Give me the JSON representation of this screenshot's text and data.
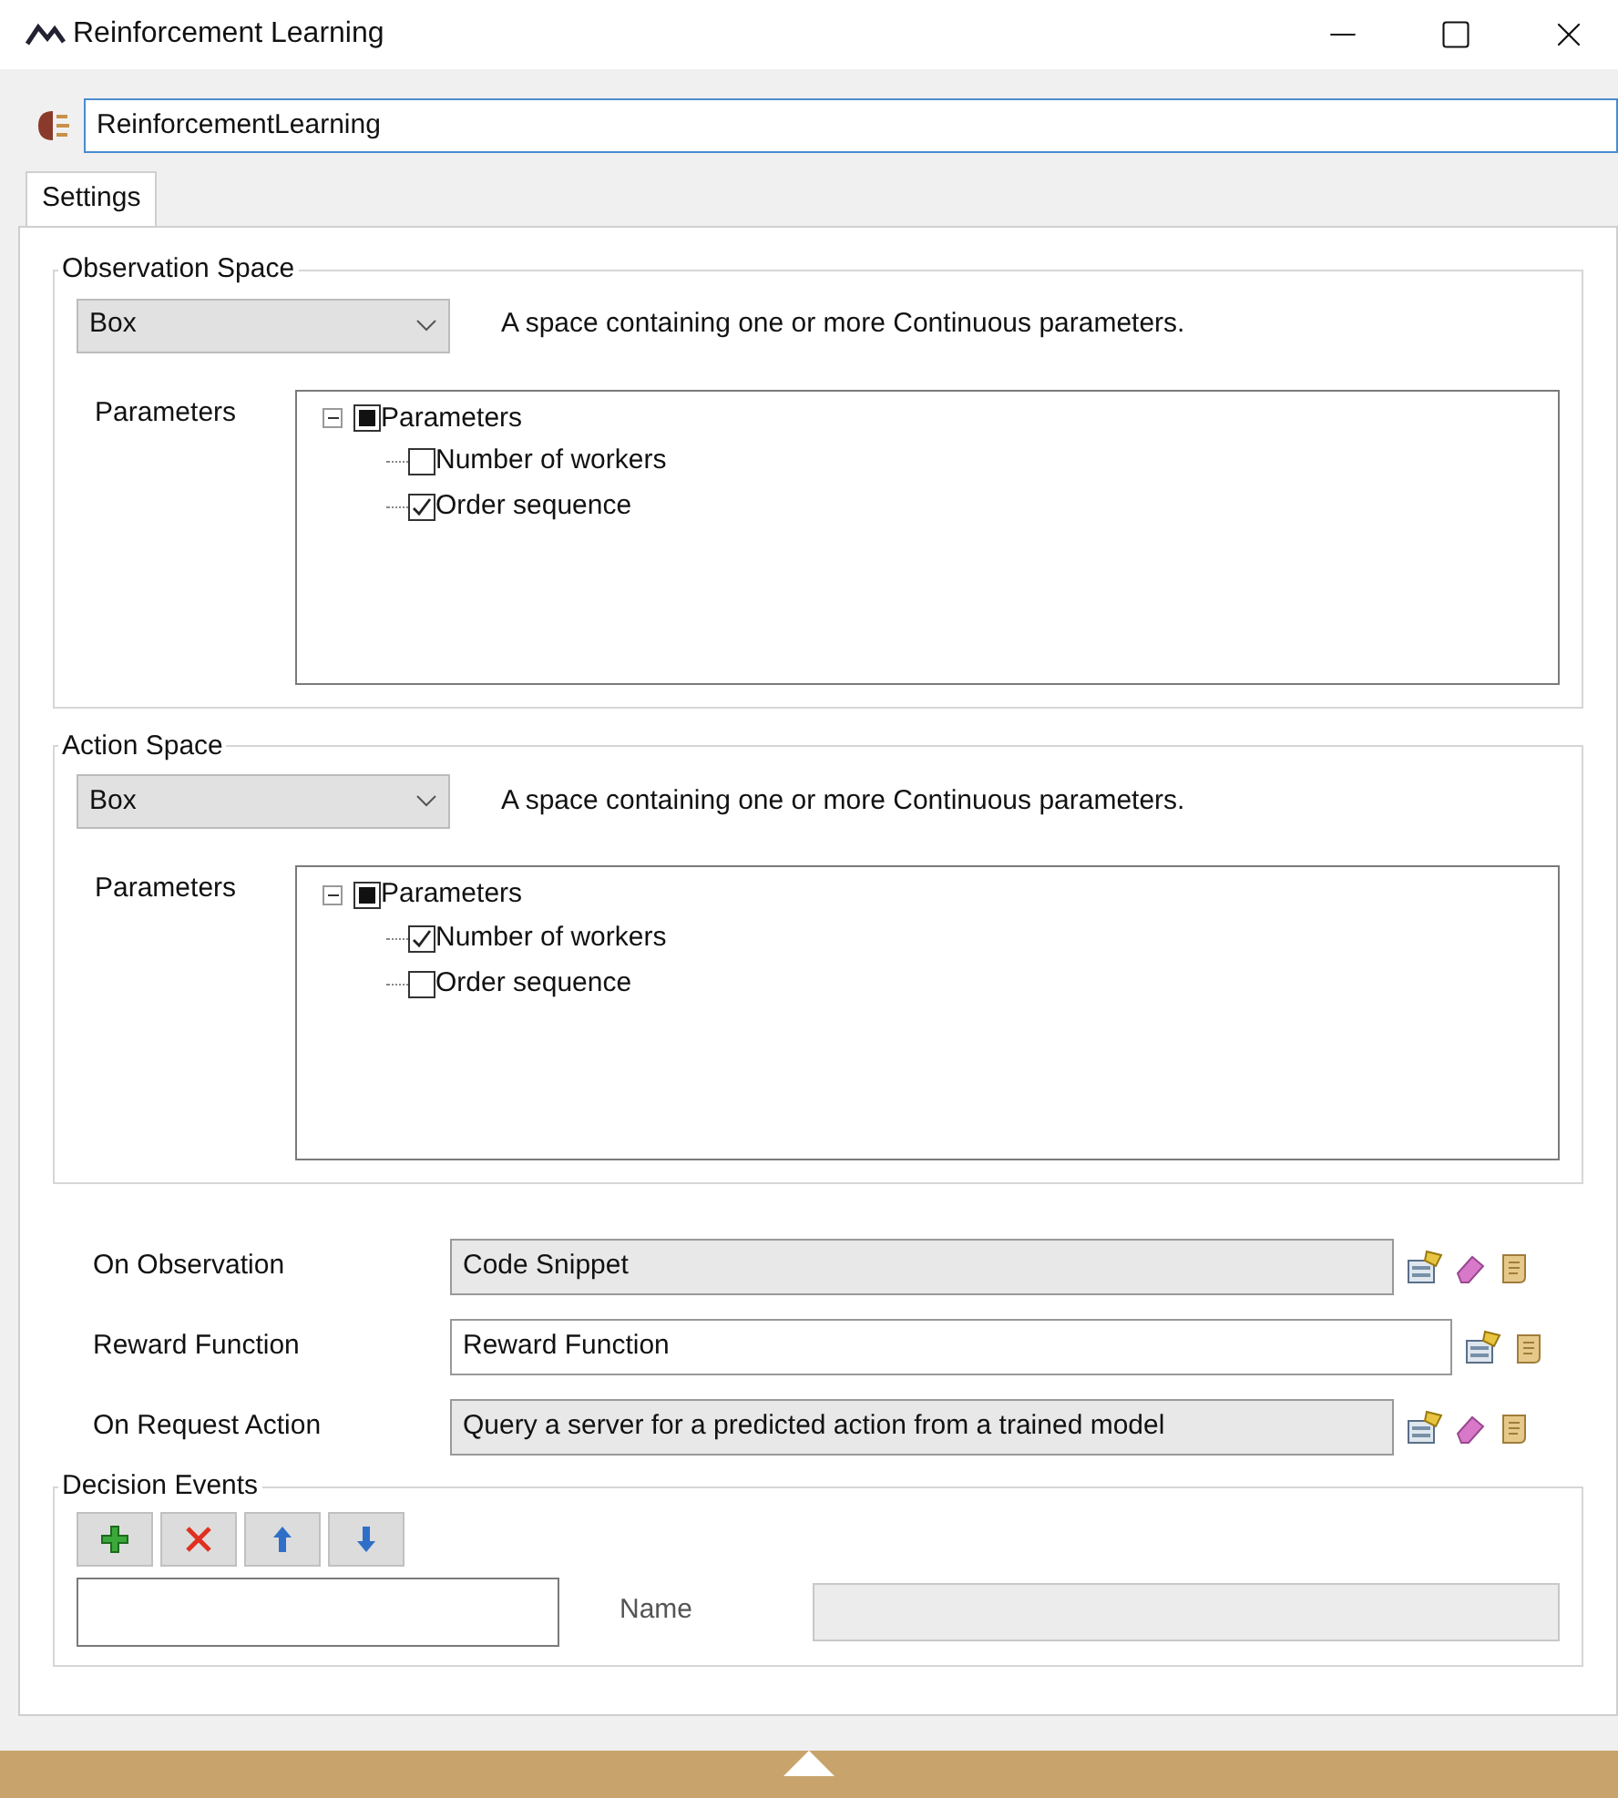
{
  "window": {
    "title": "Reinforcement Learning"
  },
  "name_field": {
    "value": "ReinforcementLearning"
  },
  "tabs": [
    {
      "label": "Settings",
      "selected": true
    }
  ],
  "spaces": [
    {
      "title": "Observation Space",
      "space_type": "Box",
      "description": "A space containing one or more Continuous parameters.",
      "parameters_label": "Parameters",
      "tree": {
        "label": "Parameters",
        "expanded": true,
        "indeterminate": true,
        "children": [
          {
            "label": "Number of workers",
            "checked": false
          },
          {
            "label": "Order sequence",
            "checked": true
          }
        ]
      }
    },
    {
      "title": "Action Space",
      "space_type": "Box",
      "description": "A space containing one or more Continuous parameters.",
      "parameters_label": "Parameters",
      "tree": {
        "label": "Parameters",
        "expanded": true,
        "indeterminate": true,
        "children": [
          {
            "label": "Number of workers",
            "checked": true
          },
          {
            "label": "Order sequence",
            "checked": false
          }
        ]
      }
    }
  ],
  "triggers": [
    {
      "label": "On Observation",
      "value": "Code Snippet",
      "editable": false,
      "clearable": true
    },
    {
      "label": "Reward Function",
      "value": "Reward Function",
      "editable": true,
      "clearable": false
    },
    {
      "label": "On Request Action",
      "value": "Query a server for a predicted action from a trained model",
      "editable": false,
      "clearable": true
    }
  ],
  "decision_events": {
    "title": "Decision Events",
    "buttons": [
      {
        "kind": "add"
      },
      {
        "kind": "remove"
      },
      {
        "kind": "up"
      },
      {
        "kind": "down"
      }
    ],
    "name_label": "Name"
  }
}
